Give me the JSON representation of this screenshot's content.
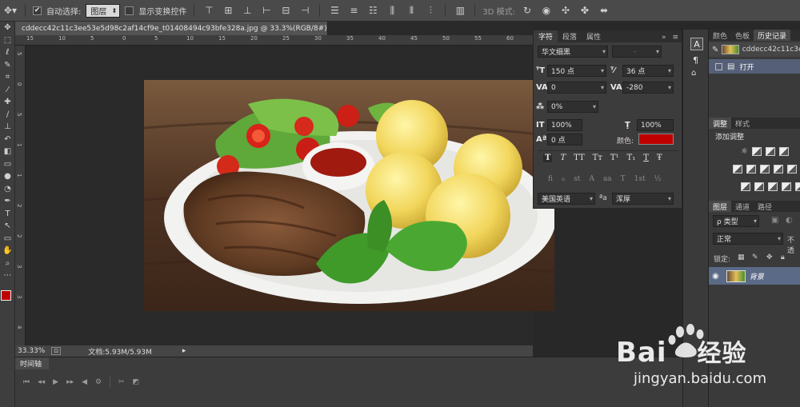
{
  "options_bar": {
    "auto_select_label": "自动选择:",
    "auto_select_target": "图层",
    "show_transform_label": "显示变换控件",
    "mode_3d_label": "3D 模式:"
  },
  "document": {
    "tab_title": "cddecc42c11c3ee53e5d98c2af14cf9e_t01408494c93bfe328a.jpg @ 33.3%(RGB/8#)",
    "tab_close": "×",
    "ruler_top": [
      "15",
      "10",
      "5",
      "0",
      "5",
      "10",
      "15",
      "20",
      "25",
      "30",
      "35",
      "40",
      "45",
      "50",
      "55",
      "60",
      "65"
    ],
    "ruler_left": [
      "5",
      "0",
      "5",
      "1",
      "1",
      "2",
      "2",
      "3",
      "3",
      "4"
    ],
    "zoom": "33.33%",
    "doc_size": "文档:5.93M/5.93M"
  },
  "timeline": {
    "title": "时间轴"
  },
  "character_panel": {
    "tabs": [
      "字符",
      "段落",
      "属性"
    ],
    "font_family": "华文细黑",
    "font_style": "-",
    "font_size": "150 点",
    "leading": "36 点",
    "kerning": "0",
    "tracking": "-280",
    "scale_proportional": "0%",
    "vertical_scale": "100%",
    "horizontal_scale": "100%",
    "baseline_shift": "0 点",
    "color_label": "颜色:",
    "text_color": "#c00000",
    "style_buttons": [
      "T",
      "T",
      "TT",
      "Tт",
      "T¹",
      "T₁",
      "T",
      "Ŧ"
    ],
    "opentype_buttons": [
      "fi",
      "ℴ",
      "st",
      "A",
      "aa",
      "T",
      "1st",
      "½"
    ],
    "language": "美国英语",
    "aa_label": "ªa",
    "anti_alias": "浑厚"
  },
  "right_panels": {
    "top_tabs": [
      "颜色",
      "色板",
      "历史记录"
    ],
    "history_snapshot": "cddecc42c11c3e",
    "history_open": "打开",
    "adjust_tabs": [
      "调整",
      "样式"
    ],
    "add_adjustment": "添加调整",
    "layers_tabs": [
      "图层",
      "通道",
      "路径"
    ],
    "kind_filter": "ρ 类型",
    "blend_mode": "正常",
    "opacity_label": "不透",
    "lock_label": "锁定:",
    "layer_name": "背景"
  },
  "watermark": {
    "brand": "Bai",
    "brand_tail": "经验",
    "url": "jingyan.baidu.com"
  },
  "colors": {
    "accent": "#c00000",
    "panel_bg": "#3c3c3c",
    "workspace": "#282828"
  }
}
